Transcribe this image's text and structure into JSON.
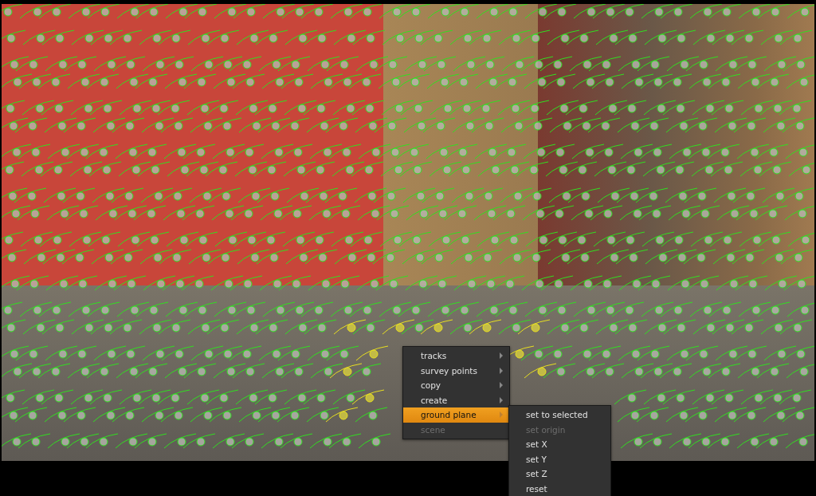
{
  "context_menu": {
    "items": [
      {
        "label": "tracks",
        "has_submenu": true,
        "selected": false,
        "disabled": false
      },
      {
        "label": "survey points",
        "has_submenu": true,
        "selected": false,
        "disabled": false
      },
      {
        "label": "copy",
        "has_submenu": true,
        "selected": false,
        "disabled": false
      },
      {
        "label": "create",
        "has_submenu": true,
        "selected": false,
        "disabled": false
      },
      {
        "label": "ground plane",
        "has_submenu": true,
        "selected": true,
        "disabled": false
      },
      {
        "label": "scene",
        "has_submenu": false,
        "selected": false,
        "disabled": true
      }
    ]
  },
  "submenu": {
    "items": [
      {
        "label": "set to selected",
        "disabled": false
      },
      {
        "label": "set origin",
        "disabled": true
      },
      {
        "label": "set X",
        "disabled": false
      },
      {
        "label": "set Y",
        "disabled": false
      },
      {
        "label": "set Z",
        "disabled": false
      },
      {
        "label": "reset",
        "disabled": false
      }
    ]
  }
}
